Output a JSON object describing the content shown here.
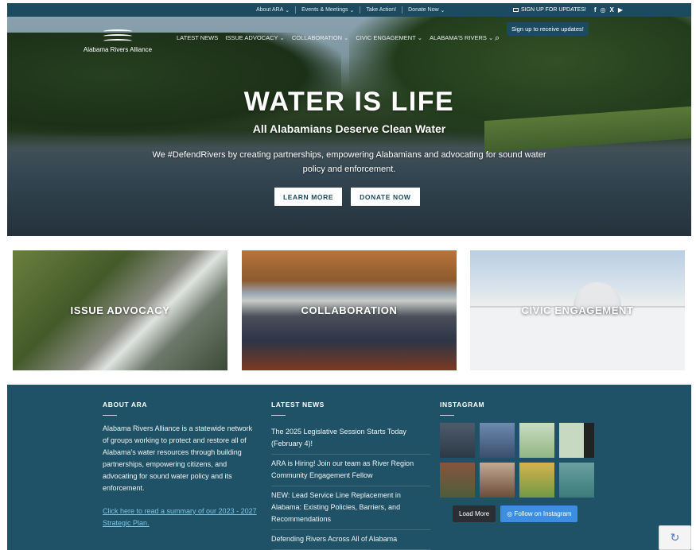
{
  "topbar": {
    "menu": [
      "About ARA",
      "Events & Meetings",
      "Take Action!",
      "Donate Now"
    ],
    "signup": "SIGN UP FOR UPDATES!",
    "social": [
      "f",
      "◎",
      "X",
      "▶"
    ]
  },
  "logo": {
    "name": "Alabama Rivers Alliance"
  },
  "nav": [
    "LATEST NEWS",
    "ISSUE ADVOCACY",
    "COLLABORATION",
    "CIVIC ENGAGEMENT",
    "ALABAMA'S RIVERS"
  ],
  "tooltip": "Sign up to receive updates!",
  "hero": {
    "headline": "WATER IS LIFE",
    "subhead": "All Alabamians Deserve Clean Water",
    "blurb": "We #DefendRivers by creating partnerships, empowering Alabamians and advocating for sound water policy and enforcement.",
    "learn_more": "LEARN MORE",
    "donate": "DONATE NOW"
  },
  "cards": [
    "ISSUE ADVOCACY",
    "COLLABORATION",
    "CIVIC ENGAGEMENT"
  ],
  "footer": {
    "about_title": "ABOUT ARA",
    "about_text": "Alabama Rivers Alliance is a statewide network of groups working to protect and restore all of Alabama's water resources through building partnerships, empowering citizens, and advocating for sound water policy and its enforcement.",
    "about_link": "Click here to read a summary of our 2023 - 2027 Strategic Plan.",
    "news_title": "LATEST NEWS",
    "news": [
      "The 2025 Legislative Session Starts Today (February 4)!",
      "ARA is Hiring! Join our team as River Region Community Engagement Fellow",
      "NEW: Lead Service Line Replacement in Alabama: Existing Policies, Barriers, and Recommendations",
      "Defending Rivers Across All of Alabama"
    ],
    "insta_title": "INSTAGRAM",
    "load_more": "Load More",
    "follow": "Follow on Instagram"
  },
  "colors": {
    "brand": "#1f5266",
    "topbar": "#1c4a5e",
    "link": "#7bc3e6",
    "follow_button": "#3d8ee0"
  }
}
